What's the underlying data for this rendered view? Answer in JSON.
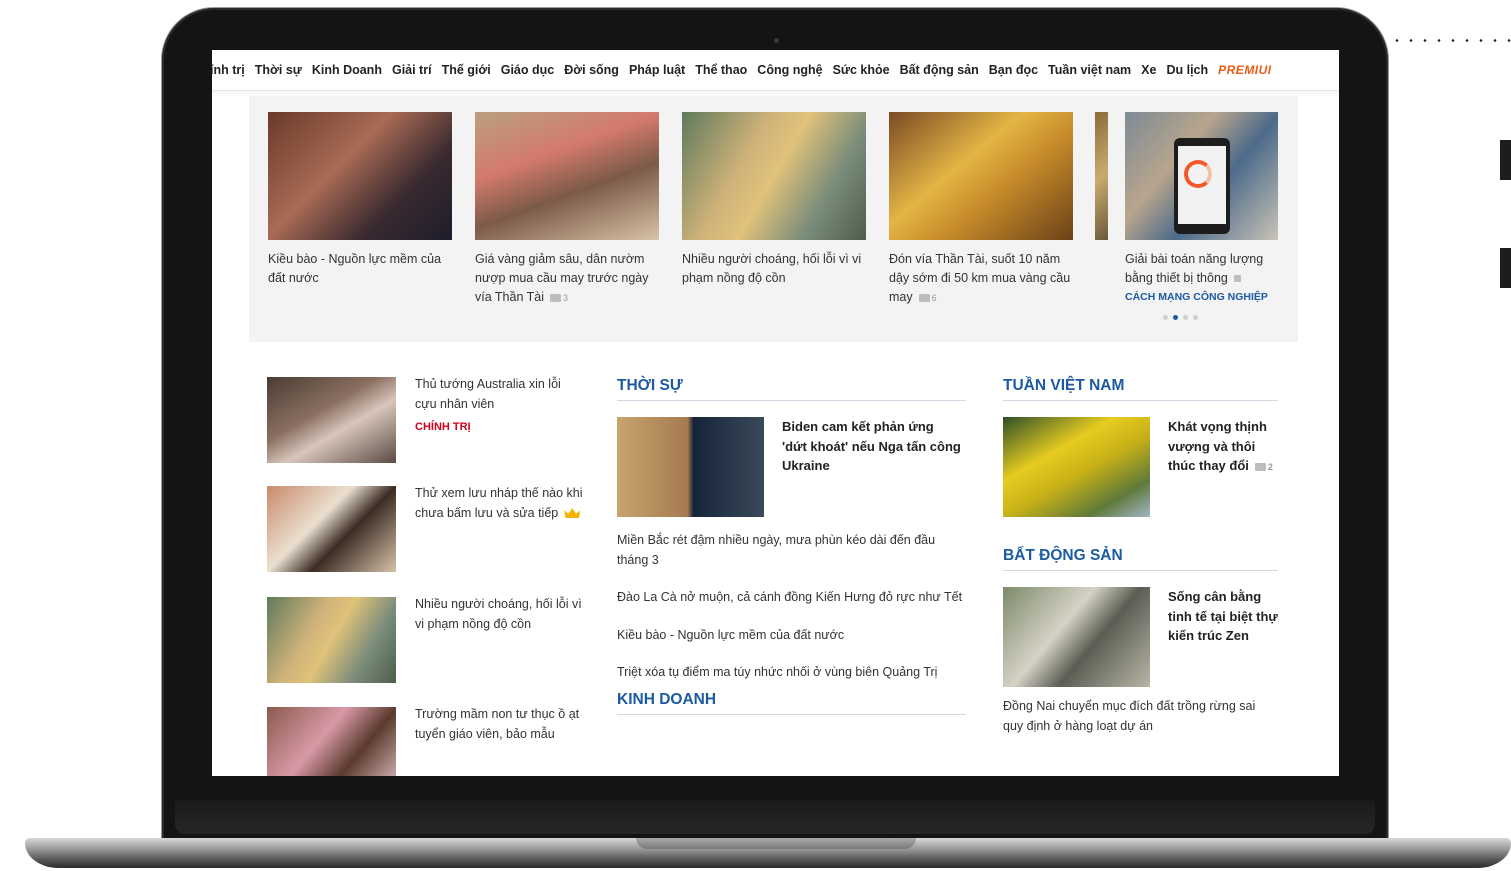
{
  "nav": {
    "items": [
      "ính trị",
      "Thời sự",
      "Kinh Doanh",
      "Giải trí",
      "Thế giới",
      "Giáo dục",
      "Đời sống",
      "Pháp luật",
      "Thể thao",
      "Công nghệ",
      "Sức khỏe",
      "Bất động sản",
      "Bạn đọc",
      "Tuần việt nam",
      "Xe",
      "Du lịch"
    ],
    "premium": "PREMIUI"
  },
  "slider": {
    "s1": {
      "caption": "Kiều bào - Nguồn lực mềm của đất nước"
    },
    "s2": {
      "caption": "Giá vàng giảm sâu, dân nườm nượp mua cầu may trước ngày vía Thần Tài",
      "comments": "3"
    },
    "s3": {
      "caption": "Nhiều người choáng, hối lỗi vì vi phạm nồng độ cồn"
    },
    "s4": {
      "caption": "Đón vía Thần Tài, suốt 10 năm dậy sớm đi 50 km mua vàng cầu may",
      "comments": "6"
    },
    "s5": {
      "caption": "Giải bài toán năng lượng bằng thiết bị thông",
      "tag": "CÁCH MẠNG CÔNG NGHIỆP"
    }
  },
  "left": {
    "r1": {
      "title": "Thủ tướng Australia xin lỗi cựu nhân viên",
      "tag": "CHÍNH TRỊ"
    },
    "r2": {
      "title": "Thử xem lưu nháp thế nào khi chưa bấm lưu và sửa tiếp"
    },
    "r3": {
      "title": "Nhiều người choáng, hối lỗi vì vi phạm nồng độ cồn"
    },
    "r4": {
      "title": "Trường mầm non tư thục ồ ạt tuyển giáo viên, bảo mẫu"
    }
  },
  "thoisu": {
    "heading": "THỜI SỰ",
    "feature": "Biden cam kết phản ứng 'dứt khoát' nếu Nga tấn công Ukraine",
    "links": [
      "Miền Bắc rét đậm nhiều ngày, mưa phùn kéo dài đến đầu tháng 3",
      "Đào La Cà nở muộn, cả cánh đồng Kiến Hưng đỏ rực như Tết",
      "Kiều bào - Nguồn lực mềm của đất nước",
      "Triệt xóa tụ điểm ma túy nhức nhối ở vùng biên Quảng Trị"
    ]
  },
  "kinhdoanh": {
    "heading": "KINH DOANH"
  },
  "tuanvietnam": {
    "heading": "TUẦN VIỆT NAM",
    "feature": "Khát vọng thịnh vượng và thôi thúc thay đổi",
    "comments": "2"
  },
  "batdongsan": {
    "heading": "BẤT ĐỘNG SẢN",
    "feature": "Sống cân bằng tinh tế tại biệt thự kiến trúc Zen",
    "link": "Đồng Nai chuyển mục đích đất trồng rừng sai quy định ở hàng loạt dự án"
  }
}
